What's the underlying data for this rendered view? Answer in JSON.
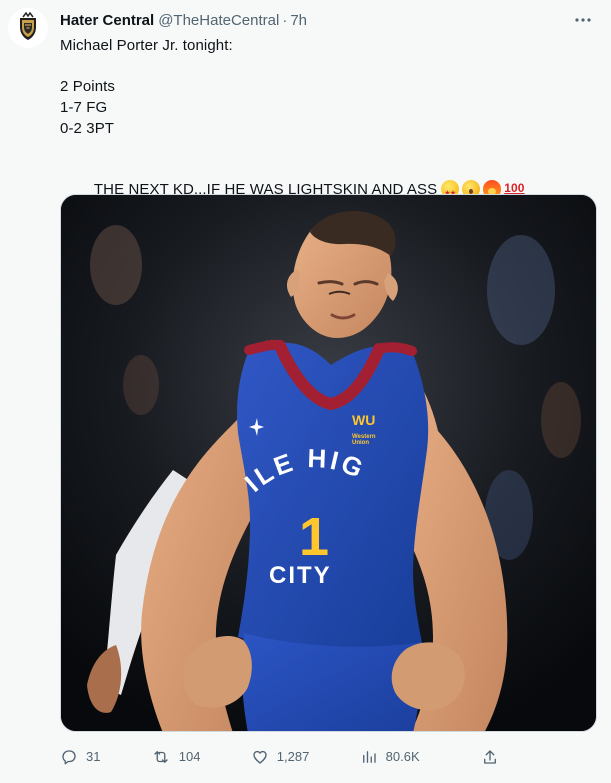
{
  "tweet": {
    "author": {
      "display_name": "Hater Central",
      "handle": "@TheHateCentral",
      "separator": "·",
      "time": "7h"
    },
    "text_lines": [
      "Michael Porter Jr. tonight:",
      "",
      "2 Points",
      "1-7 FG",
      "0-2 3PT",
      "",
      "THE NEXT KD...IF HE WAS LIGHTSKIN AND ASS"
    ],
    "emojis": [
      "star-struck-emoji",
      "exploding-head-emoji",
      "fire-emoji",
      "hundred-points-emoji"
    ],
    "media": {
      "jersey_top": "MILE HIGH",
      "jersey_number": "1",
      "jersey_bottom": "CITY",
      "sponsor_logo": "WU",
      "sponsor_text_line_1": "Western",
      "sponsor_text_line_2": "Union"
    },
    "metrics": {
      "replies": "31",
      "retweets": "104",
      "likes": "1,287",
      "views": "80.6K"
    },
    "icons": {
      "more": "more-icon",
      "reply": "reply-icon",
      "retweet": "retweet-icon",
      "like": "heart-icon",
      "views": "views-icon",
      "share": "share-icon"
    },
    "colors": {
      "background": "#f7f9f9",
      "text_primary": "#0f1419",
      "text_secondary": "#536471",
      "jersey_blue": "#2547a8",
      "jersey_red": "#a32032",
      "jersey_yellow": "#ffc72c"
    }
  }
}
